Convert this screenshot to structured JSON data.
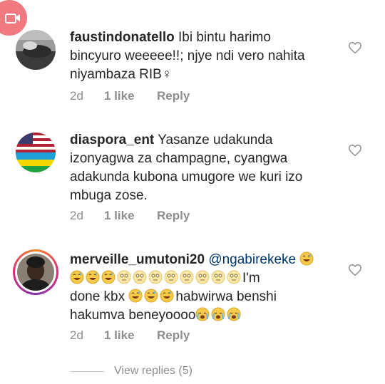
{
  "comments": [
    {
      "username": "faustindonatello",
      "text": "Ibi bintu harimo bincyuro weeeee!!; njye ndi vero nahita niyambaza RIB🤦‍♀️",
      "text_line1": " Ibi bintu harimo",
      "text_line2": "bincyuro weeeee!!; njye ndi vero nahita",
      "text_line3": "niyambaza RIB♀",
      "time": "2d",
      "likes": "1 like",
      "reply": "Reply"
    },
    {
      "username": "diaspora_ent",
      "text_line1": " Yasanze udakunda",
      "text_line2": "izonyagwa za champagne, cyangwa",
      "text_line3": "adakunda kubona umugore we kuri izo",
      "text_line4": "mbuga zose.",
      "time": "2d",
      "likes": "1 like",
      "reply": "Reply"
    },
    {
      "username": "merveille_umutoni20",
      "mention": "@ngabirekeke",
      "text_line2_end": "I'm",
      "text_line3_start": "done kbx",
      "text_line3_end": "habwirwa benshi",
      "text_line4": "hakumva beneyoooo",
      "time": "2d",
      "likes": "1 like",
      "reply": "Reply"
    }
  ],
  "view_replies": "View replies (5)",
  "colors": {
    "username": "#262626",
    "meta": "#8e8e8e",
    "mention": "#00376b",
    "badge": "#f07a80"
  },
  "icons": [
    "camera-icon",
    "heart-icon",
    "grinning-sweat-emoji",
    "flushed-emoji",
    "crying-emoji"
  ]
}
